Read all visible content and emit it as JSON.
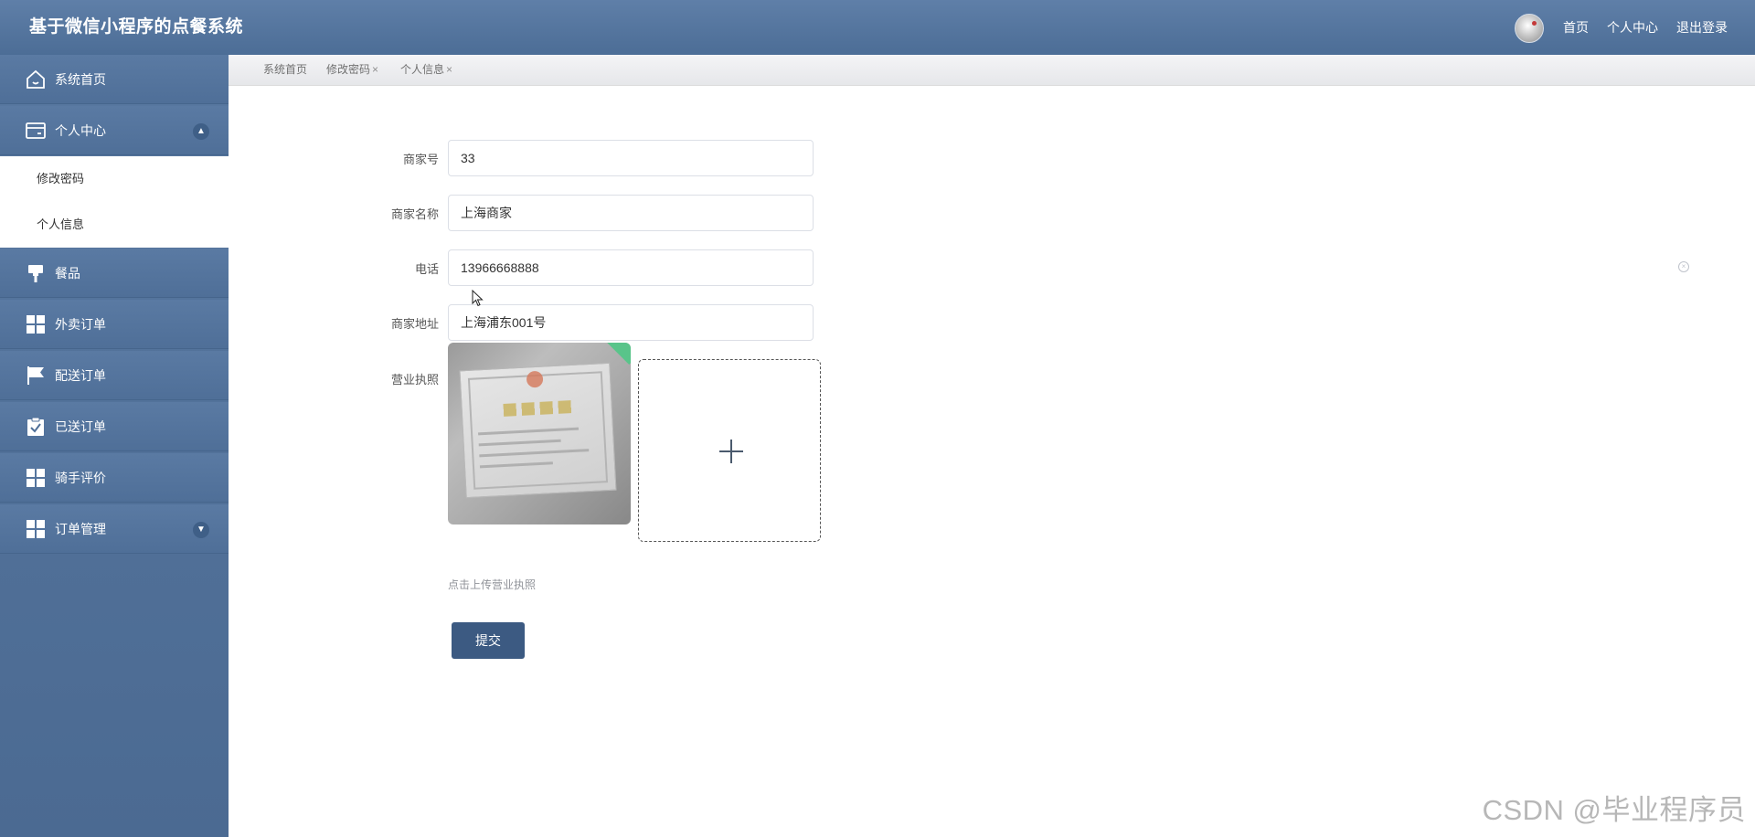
{
  "header": {
    "title": "基于微信小程序的点餐系统",
    "nav": [
      {
        "label": "首页"
      },
      {
        "label": "个人中心"
      },
      {
        "label": "退出登录"
      }
    ]
  },
  "sidebar": {
    "items": [
      {
        "label": "系统首页",
        "icon": "home-icon"
      },
      {
        "label": "个人中心",
        "icon": "wallet-icon",
        "expanded": true,
        "children": [
          {
            "label": "修改密码"
          },
          {
            "label": "个人信息"
          }
        ]
      },
      {
        "label": "餐品",
        "icon": "brush-icon"
      },
      {
        "label": "外卖订单",
        "icon": "grid-icon"
      },
      {
        "label": "配送订单",
        "icon": "flag-icon"
      },
      {
        "label": "已送订单",
        "icon": "clipboard-check-icon"
      },
      {
        "label": "骑手评价",
        "icon": "grid-icon"
      },
      {
        "label": "订单管理",
        "icon": "grid-icon",
        "expanded": false
      }
    ]
  },
  "tabs": [
    {
      "label": "系统首页",
      "closable": false
    },
    {
      "label": "修改密码",
      "closable": true
    },
    {
      "label": "个人信息",
      "closable": true
    }
  ],
  "form": {
    "fields": [
      {
        "label": "商家号",
        "value": "33"
      },
      {
        "label": "商家名称",
        "value": "上海商家"
      },
      {
        "label": "电话",
        "value": "13966668888"
      },
      {
        "label": "商家地址",
        "value": "上海浦东001号"
      }
    ],
    "license_label": "营业执照",
    "upload_hint": "点击上传营业执照",
    "submit_label": "提交"
  },
  "watermark": "CSDN @毕业程序员",
  "colors": {
    "header": "#4c6d96",
    "sidebar": "#4f6f98",
    "primary_button": "#3c5a82"
  }
}
